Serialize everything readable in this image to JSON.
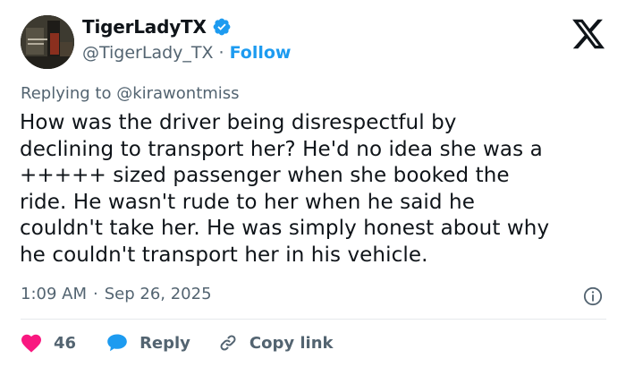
{
  "author": {
    "display_name": "TigerLadyTX",
    "handle": "@TigerLady_TX",
    "separator": "·",
    "follow_label": "Follow",
    "verified_color": "#1d9bf0"
  },
  "reply_prefix": "Replying to ",
  "reply_mention": "@kirawontmiss",
  "body": "How was the driver being disrespectful by\ndeclining to transport her? He'd no idea she was a\n+++++ sized passenger when she booked the\nride. He wasn't rude to her when he said he\ncouldn't take her. He was simply honest about why\nhe couldn't transport her in his vehicle.",
  "meta": {
    "time": "1:09 AM",
    "separator": "·",
    "date": "Sep 26, 2025"
  },
  "actions": {
    "like_count": "46",
    "reply_label": "Reply",
    "copy_label": "Copy link"
  },
  "colors": {
    "heart": "#f91880",
    "reply_bubble": "#1d9bf0",
    "link_icon": "#536471",
    "muted_text": "#536471"
  },
  "icons": [
    "x-logo-icon",
    "verified-badge-icon",
    "info-icon",
    "heart-icon",
    "reply-bubble-icon",
    "link-icon"
  ]
}
